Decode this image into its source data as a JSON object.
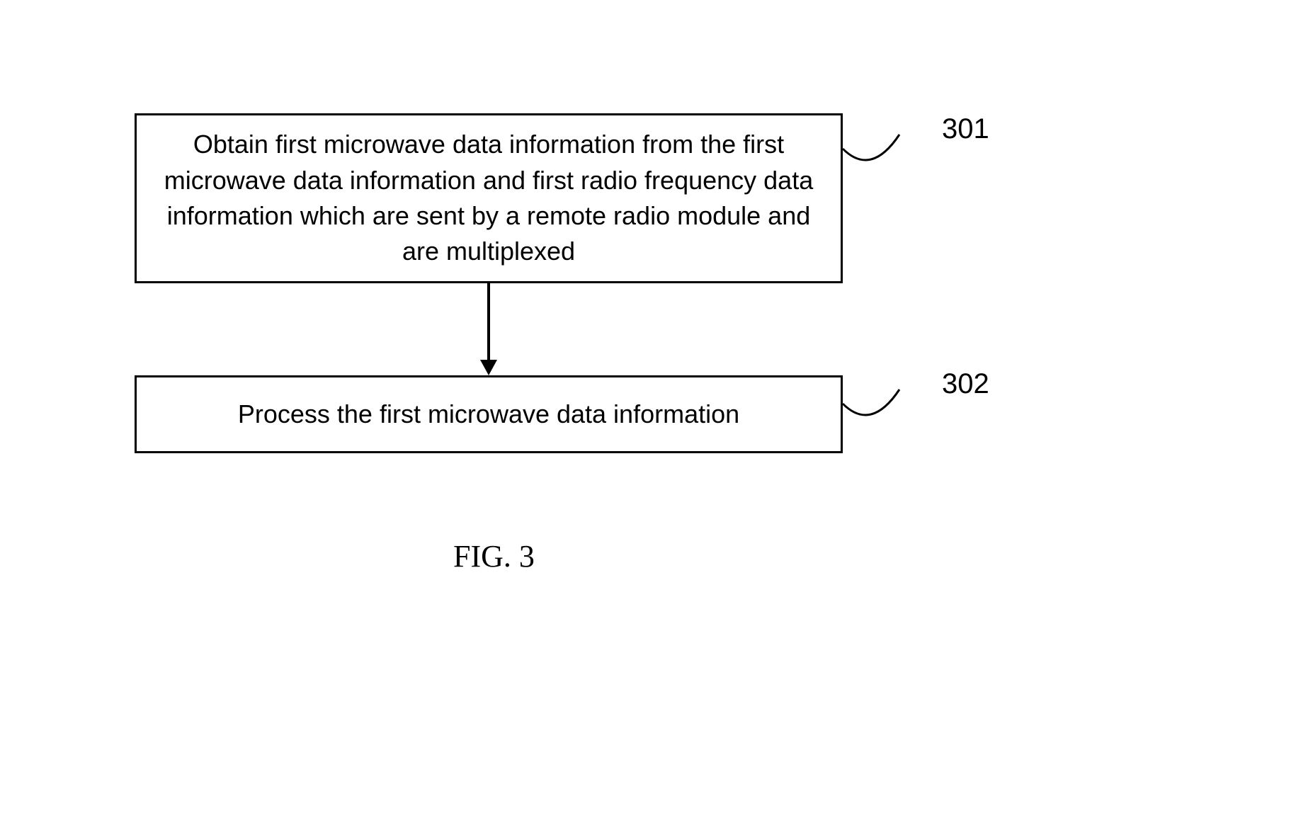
{
  "steps": [
    {
      "label": "301",
      "text": "Obtain first microwave data information from the first microwave data information and first radio frequency data information which are sent by a remote radio module and are multiplexed"
    },
    {
      "label": "302",
      "text": "Process the first microwave data information"
    }
  ],
  "caption": "FIG. 3"
}
